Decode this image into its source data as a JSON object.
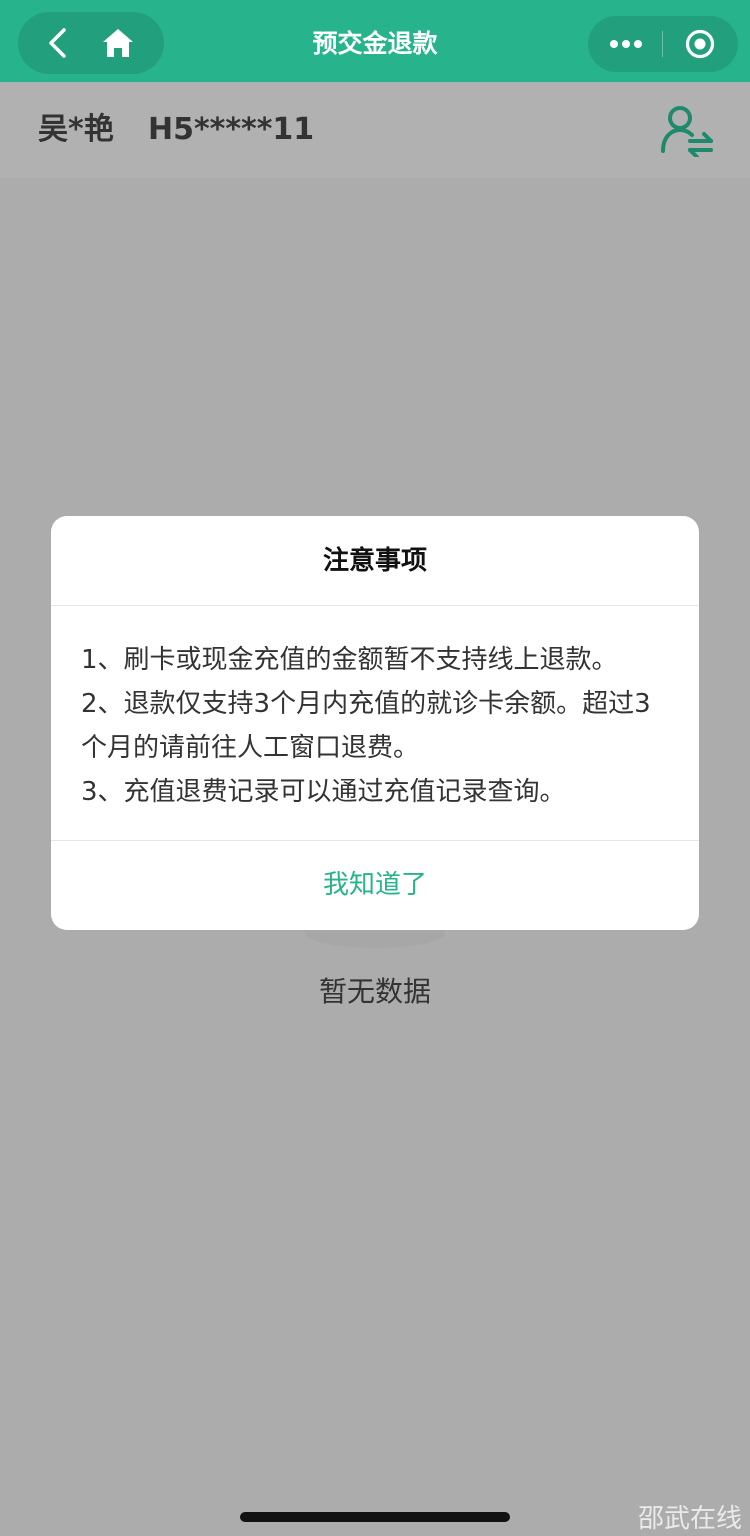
{
  "header": {
    "title": "预交金退款"
  },
  "patient": {
    "name": "吴*艳",
    "id": "H5*****11"
  },
  "modal": {
    "title": "注意事项",
    "lines": [
      "1、刷卡或现金充值的金额暂不支持线上退款。",
      "2、退款仅支持3个月内充值的就诊卡余额。超过3个月的请前往人工窗口退费。",
      "3、充值退费记录可以通过充值记录查询。"
    ],
    "confirm_label": "我知道了"
  },
  "empty_state": {
    "text": "暂无数据"
  },
  "watermark": "邵武在线",
  "icons": {
    "back": "back-chevron-icon",
    "home": "home-icon",
    "more": "more-dots-icon",
    "close": "target-circle-icon",
    "switch": "switch-user-icon"
  },
  "colors": {
    "primary": "#27b48c",
    "overlay": "#acacac"
  }
}
